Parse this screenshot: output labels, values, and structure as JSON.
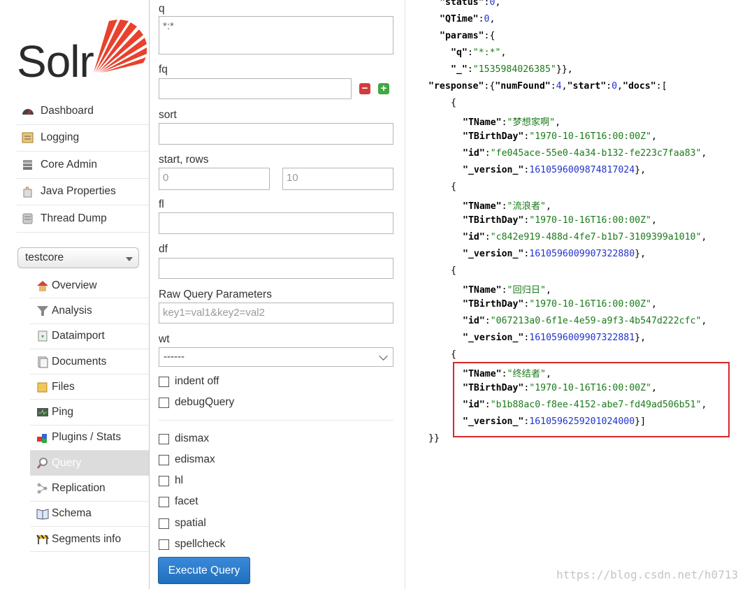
{
  "logo": {
    "text": "Solr"
  },
  "main_nav": [
    {
      "label": "Dashboard",
      "icon": "dashboard-icon"
    },
    {
      "label": "Logging",
      "icon": "logging-icon"
    },
    {
      "label": "Core Admin",
      "icon": "core-admin-icon"
    },
    {
      "label": "Java Properties",
      "icon": "java-icon"
    },
    {
      "label": "Thread Dump",
      "icon": "thread-dump-icon"
    }
  ],
  "core_selector": {
    "value": "testcore"
  },
  "core_nav": [
    {
      "label": "Overview",
      "icon": "home-icon"
    },
    {
      "label": "Analysis",
      "icon": "funnel-icon"
    },
    {
      "label": "Dataimport",
      "icon": "dataimport-icon"
    },
    {
      "label": "Documents",
      "icon": "documents-icon"
    },
    {
      "label": "Files",
      "icon": "folder-icon"
    },
    {
      "label": "Ping",
      "icon": "ping-icon"
    },
    {
      "label": "Plugins / Stats",
      "icon": "plugins-icon"
    },
    {
      "label": "Query",
      "icon": "magnifier-icon",
      "active": true
    },
    {
      "label": "Replication",
      "icon": "replication-icon"
    },
    {
      "label": "Schema",
      "icon": "schema-icon"
    },
    {
      "label": "Segments info",
      "icon": "segments-icon"
    }
  ],
  "form": {
    "q_label": "q",
    "q_value": "*:*",
    "fq_label": "fq",
    "fq_value": "",
    "sort_label": "sort",
    "sort_value": "",
    "start_rows_label": "start, rows",
    "start_value": "0",
    "rows_value": "10",
    "fl_label": "fl",
    "fl_value": "",
    "df_label": "df",
    "df_value": "",
    "raw_label": "Raw Query Parameters",
    "raw_placeholder": "key1=val1&key2=val2",
    "wt_label": "wt",
    "wt_value": "------",
    "indent_label": "indent off",
    "debug_label": "debugQuery",
    "dismax_label": "dismax",
    "edismax_label": "edismax",
    "hl_label": "hl",
    "facet_label": "facet",
    "spatial_label": "spatial",
    "spellcheck_label": "spellcheck",
    "execute_label": "Execute Query"
  },
  "response": {
    "status": "0",
    "qtime": "0",
    "params_q": "\"*:*\"",
    "params_underscore": "\"1535984026385\"",
    "num_found": "4",
    "start": "0",
    "docs": [
      {
        "tname": "\"梦想家啊\"",
        "tbirthday": "\"1970-10-16T16:00:00Z\"",
        "id": "\"fe045ace-55e0-4a34-b132-fe223c7faa83\"",
        "version": "1610596009874817024"
      },
      {
        "tname": "\"流浪者\"",
        "tbirthday": "\"1970-10-16T16:00:00Z\"",
        "id": "\"c842e919-488d-4fe7-b1b7-3109399a1010\"",
        "version": "1610596009907322880"
      },
      {
        "tname": "\"回归日\"",
        "tbirthday": "\"1970-10-16T16:00:00Z\"",
        "id": "\"067213a0-6f1e-4e59-a9f3-4b547d222cfc\"",
        "version": "1610596009907322881"
      },
      {
        "tname": "\"终结者\"",
        "tbirthday": "\"1970-10-16T16:00:00Z\"",
        "id": "\"b1b88ac0-f8ee-4152-abe7-fd49ad506b51\"",
        "version": "1610596259201024000"
      }
    ]
  },
  "watermark": "https://blog.csdn.net/h0713",
  "colors": {
    "accent": "#1f6fbf",
    "highlight_border": "#d9262b",
    "json_string": "#1a7a1a",
    "json_number": "#2233cc",
    "logo_sun": "#e8412c"
  }
}
